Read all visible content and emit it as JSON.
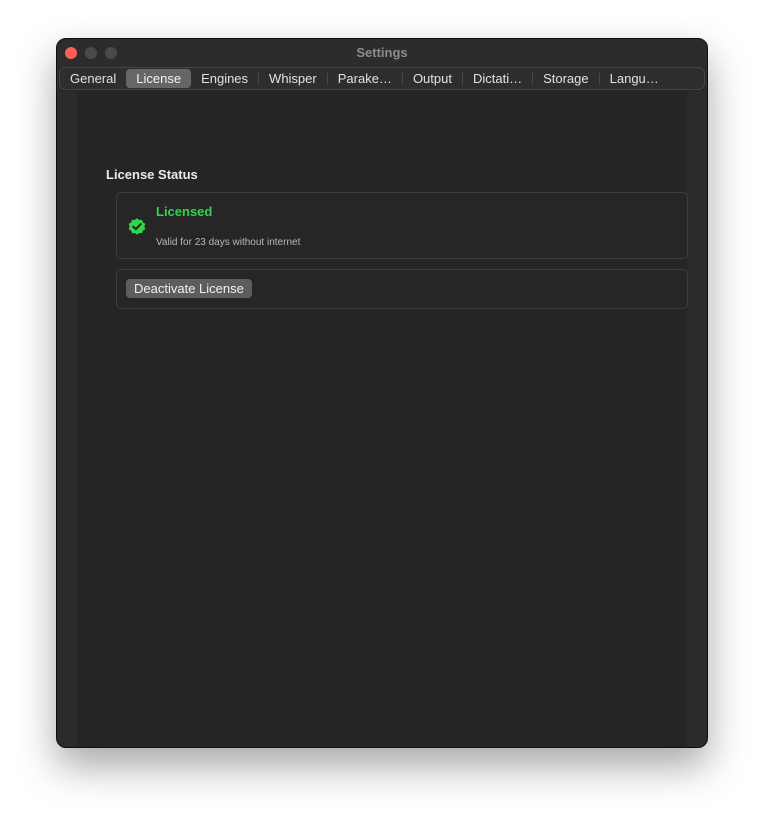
{
  "window": {
    "title": "Settings"
  },
  "tabs": [
    {
      "label": "General",
      "selected": false
    },
    {
      "label": "License",
      "selected": true
    },
    {
      "label": "Engines",
      "selected": false
    },
    {
      "label": "Whisper",
      "selected": false
    },
    {
      "label": "Parake…",
      "selected": false
    },
    {
      "label": "Output",
      "selected": false
    },
    {
      "label": "Dictati…",
      "selected": false
    },
    {
      "label": "Storage",
      "selected": false
    },
    {
      "label": "Langu…",
      "selected": false
    }
  ],
  "license": {
    "section_title": "License Status",
    "status": "Licensed",
    "detail": "Valid for 23 days without internet",
    "status_icon": "verified-badge-icon",
    "status_color": "#35d24e",
    "deactivate_label": "Deactivate License"
  },
  "colors": {
    "close_button": "#ff5f57",
    "selected_tab": "#666666",
    "window_bg": "#262626"
  }
}
